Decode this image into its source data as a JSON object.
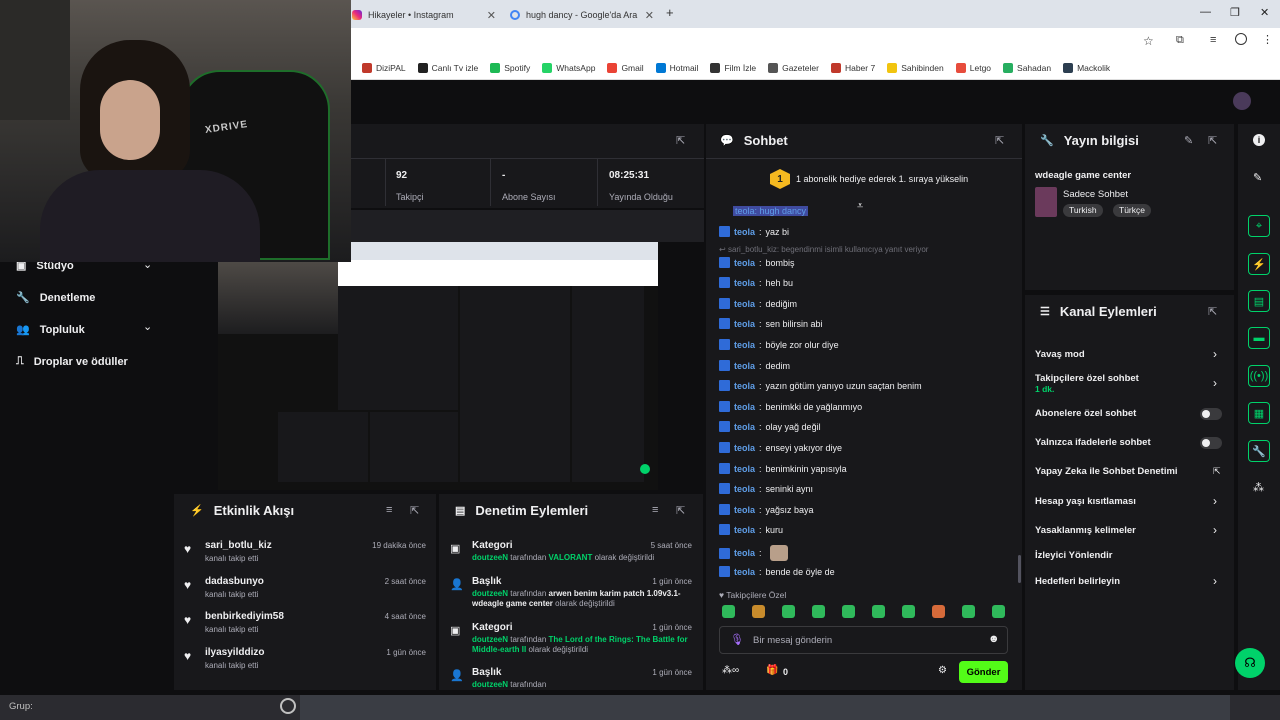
{
  "browser": {
    "tabs": [
      {
        "label": "Hikayeler • Instagram"
      },
      {
        "label": "hugh dancy - Google'da Ara"
      }
    ],
    "new_tab_symbol": "+",
    "bookmarks": [
      {
        "label": "DiziPAL",
        "color": "#c0392b"
      },
      {
        "label": "Canlı Tv izle",
        "color": "#222"
      },
      {
        "label": "Spotify",
        "color": "#1db954"
      },
      {
        "label": "WhatsApp",
        "color": "#25d366"
      },
      {
        "label": "Gmail",
        "color": "#ea4335"
      },
      {
        "label": "Hotmail",
        "color": "#0078d4"
      },
      {
        "label": "Film İzle",
        "color": "#333"
      },
      {
        "label": "Gazeteler",
        "color": "#555"
      },
      {
        "label": "Haber 7",
        "color": "#c0392b"
      },
      {
        "label": "Sahibinden",
        "color": "#f1c40f"
      },
      {
        "label": "Letgo",
        "color": "#e74c3c"
      },
      {
        "label": "Sahadan",
        "color": "#27ae60"
      },
      {
        "label": "Mackolik",
        "color": "#2c3e50"
      }
    ]
  },
  "webcam": {
    "chair_text": "XDRIVE"
  },
  "sidebar": {
    "items": [
      {
        "label": "Stüdyo"
      },
      {
        "label": "Denetleme"
      },
      {
        "label": "Topluluk"
      },
      {
        "label": "Droplar ve ödüller"
      }
    ]
  },
  "stats": [
    {
      "value": "92",
      "label": "Takipçi"
    },
    {
      "value": "-",
      "label": "Abone Sayısı"
    },
    {
      "value": "08:25:31",
      "label": "Yayında Olduğu"
    }
  ],
  "chat": {
    "title": "Sohbet",
    "hype_number": "1",
    "hype_text": "1 abonelik hediye ederek 1. sıraya yükselin",
    "reply_note": "sari_botlu_kiz: begendinmi isimli kullanıcıya yanıt veriyor",
    "top_partial": "teola: hugh dancy",
    "messages": [
      {
        "user": "teola",
        "text": "yaz bi"
      },
      {
        "user": "teola",
        "text": "bombiş"
      },
      {
        "user": "teola",
        "text": "heh bu"
      },
      {
        "user": "teola",
        "text": "dediğim"
      },
      {
        "user": "teola",
        "text": "sen bilirsin abi"
      },
      {
        "user": "teola",
        "text": "böyle zor olur diye"
      },
      {
        "user": "teola",
        "text": "dedim"
      },
      {
        "user": "teola",
        "text": "yazın götüm yanıyo uzun saçtan benim"
      },
      {
        "user": "teola",
        "text": "benimkki de yağlanmıyo"
      },
      {
        "user": "teola",
        "text": "olay yağ değil"
      },
      {
        "user": "teola",
        "text": "enseyi yakıyor diye"
      },
      {
        "user": "teola",
        "text": "benimkinin yapısıyla"
      },
      {
        "user": "teola",
        "text": "seninki aynı"
      },
      {
        "user": "teola",
        "text": "yağsız baya"
      },
      {
        "user": "teola",
        "text": "kuru"
      },
      {
        "user": "teola",
        "text": ""
      },
      {
        "user": "teola",
        "text": "bende de öyle de"
      }
    ],
    "followers_only": "Takipçilere Özel",
    "input_placeholder": "Bir mesaj gönderin",
    "points": "0",
    "send_label": "Gönder"
  },
  "stream_info": {
    "title": "Yayın bilgisi",
    "stream_title": "wdeagle game center",
    "category": "Sadece Sohbet",
    "tags": [
      "Turkish",
      "Türkçe"
    ]
  },
  "channel_actions": {
    "title": "Kanal Eylemleri",
    "items": [
      {
        "label": "Yavaş mod",
        "sub": ""
      },
      {
        "label": "Takipçilere özel sohbet",
        "sub": "1 dk."
      },
      {
        "label": "Abonelere özel sohbet",
        "sub": ""
      },
      {
        "label": "Yalnızca ifadelerle sohbet",
        "sub": ""
      },
      {
        "label": "Yapay Zeka ile Sohbet Denetimi",
        "sub": ""
      },
      {
        "label": "Hesap yaşı kısıtlaması",
        "sub": ""
      },
      {
        "label": "Yasaklanmış kelimeler",
        "sub": ""
      },
      {
        "label": "İzleyici Yönlendir",
        "sub": ""
      },
      {
        "label": "Hedefleri belirleyin",
        "sub": ""
      }
    ]
  },
  "activity": {
    "title": "Etkinlik Akışı",
    "events": [
      {
        "name": "sari_botlu_kiz",
        "sub": "kanalı takip etti",
        "time": "19 dakika önce"
      },
      {
        "name": "dadasbunyo",
        "sub": "kanalı takip etti",
        "time": "2 saat önce"
      },
      {
        "name": "benbirkediyim58",
        "sub": "kanalı takip etti",
        "time": "4 saat önce"
      },
      {
        "name": "ilyasyilddizo",
        "sub": "kanalı takip etti",
        "time": "1 gün önce"
      }
    ]
  },
  "moderation": {
    "title": "Denetim Eylemleri",
    "events": [
      {
        "kind": "Kategori",
        "time": "5 saat önce",
        "user": "doutzeeN",
        "mid": "tarafından",
        "value": "VALORANT",
        "tail": "olarak değiştirildi"
      },
      {
        "kind": "Başlık",
        "time": "1 gün önce",
        "user": "doutzeeN",
        "mid": "tarafından",
        "value": "arwen benim karim patch 1.09v3.1- wdeagle game center",
        "tail": "olarak değiştirildi"
      },
      {
        "kind": "Kategori",
        "time": "1 gün önce",
        "user": "doutzeeN",
        "mid": "tarafından",
        "value": "The Lord of the Rings: The Battle for Middle-earth II",
        "tail": "olarak değiştirildi"
      },
      {
        "kind": "Başlık",
        "time": "1 gün önce",
        "user": "doutzeeN",
        "mid": "tarafından",
        "value": "",
        "tail": ""
      }
    ]
  },
  "taskbar": {
    "group_label": "Grup:"
  },
  "colors": {
    "accent": "#00d26a",
    "panel": "#18181b",
    "bg": "#0e0e10",
    "chat_user": "#5f9ee8"
  }
}
